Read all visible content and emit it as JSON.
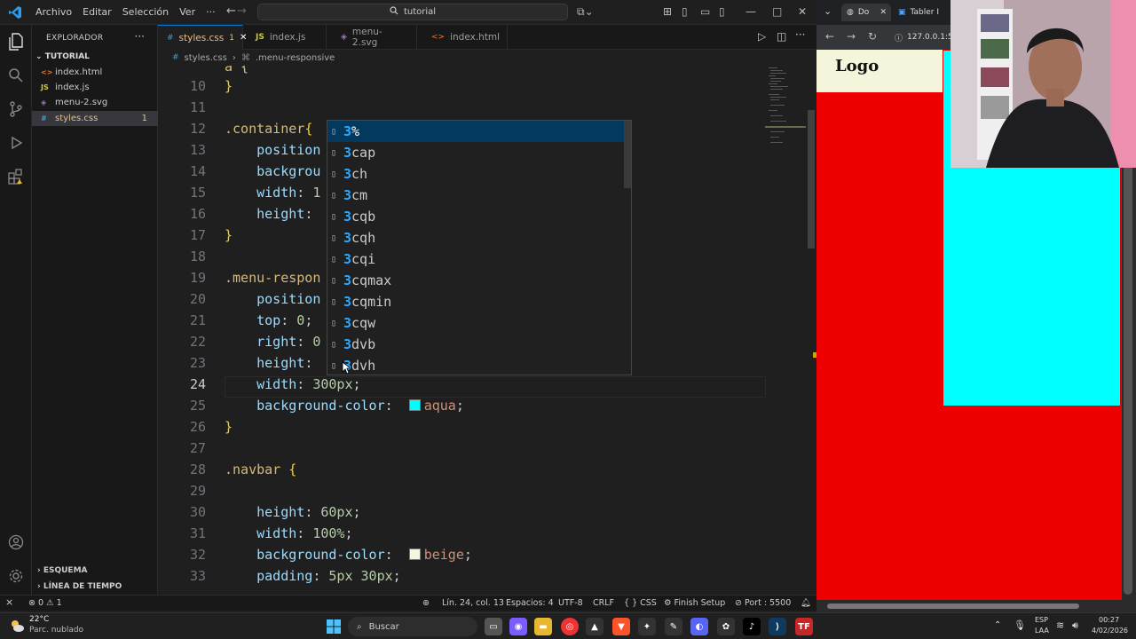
{
  "titlebar": {
    "menus": [
      "Archivo",
      "Editar",
      "Selección",
      "Ver",
      "···"
    ],
    "search": "tutorial"
  },
  "sidebar": {
    "header": "EXPLORADOR",
    "more": "···",
    "root": "TUTORIAL",
    "files": [
      {
        "name": "index.html",
        "icon": "<>",
        "color": "#e37933"
      },
      {
        "name": "index.js",
        "icon": "JS",
        "color": "#cbcb41"
      },
      {
        "name": "menu-2.svg",
        "icon": "◈",
        "color": "#a074c4"
      },
      {
        "name": "styles.css",
        "icon": "#",
        "color": "#519aba",
        "badge": "1",
        "selected": true
      }
    ],
    "sections": [
      "ESQUEMA",
      "LÍNEA DE TIEMPO"
    ]
  },
  "tabs": [
    {
      "name": "styles.css",
      "icon": "#",
      "color": "#519aba",
      "badge": "1",
      "active": true,
      "close": "✕"
    },
    {
      "name": "index.js",
      "icon": "JS",
      "color": "#cbcb41"
    },
    {
      "name": "menu-2.svg",
      "icon": "◈",
      "color": "#a074c4"
    },
    {
      "name": "index.html",
      "icon": "<>",
      "color": "#e37933"
    }
  ],
  "breadcrumb": {
    "file": "styles.css",
    "symbol": ".menu-responsive"
  },
  "editor": {
    "current_line": "24",
    "lines": [
      {
        "n": "10",
        "t": "}"
      },
      {
        "n": "11",
        "t": ""
      },
      {
        "n": "12",
        "t": ".container{"
      },
      {
        "n": "13",
        "t": "    position"
      },
      {
        "n": "14",
        "t": "    backgrou"
      },
      {
        "n": "15",
        "t": "    width: 1"
      },
      {
        "n": "16",
        "t": "    height:"
      },
      {
        "n": "17",
        "t": "}"
      },
      {
        "n": "18",
        "t": ""
      },
      {
        "n": "19",
        "t": ".menu-respon"
      },
      {
        "n": "20",
        "t": "    position"
      },
      {
        "n": "21",
        "t": "    top: 0;"
      },
      {
        "n": "22",
        "t": "    right: 0"
      },
      {
        "n": "23",
        "t": "    height:"
      },
      {
        "n": "24",
        "t": "    width: 300px;"
      },
      {
        "n": "25",
        "t": "    background-color:  aqua;"
      },
      {
        "n": "26",
        "t": "}"
      },
      {
        "n": "27",
        "t": ""
      },
      {
        "n": "28",
        "t": ".navbar {"
      },
      {
        "n": "29",
        "t": ""
      },
      {
        "n": "30",
        "t": "    height: 60px;"
      },
      {
        "n": "31",
        "t": "    width: 100%;"
      },
      {
        "n": "32",
        "t": "    background-color:  beige;"
      },
      {
        "n": "33",
        "t": "    padding: 5px 30px;"
      }
    ],
    "top_partial": "a {"
  },
  "suggestions": {
    "typed": "3",
    "items": [
      "%",
      "cap",
      "ch",
      "cm",
      "cqb",
      "cqh",
      "cqi",
      "cqmax",
      "cqmin",
      "cqw",
      "dvb",
      "dvh"
    ]
  },
  "statusbar": {
    "errors": "0",
    "warnings": "1",
    "position": "Lín. 24, col. 13",
    "spaces": "Espacios: 4",
    "encoding": "UTF-8",
    "eol": "CRLF",
    "language": "CSS",
    "setup": "Finish Setup",
    "port": "Port : 5500"
  },
  "browser": {
    "tab1": "Do",
    "tab2": "Tabler I",
    "address": "127.0.0.1:5",
    "page_logo": "Logo",
    "colors": {
      "menu": "#00ffff",
      "container": "#ee0000",
      "navbar": "#f5f5dc"
    }
  },
  "taskbar": {
    "weather_temp": "22°C",
    "weather_desc": "Parc. nublado",
    "search": "Buscar",
    "lang1": "ESP",
    "lang2": "LAA",
    "time": "00:27",
    "date": "4/02/2026"
  }
}
